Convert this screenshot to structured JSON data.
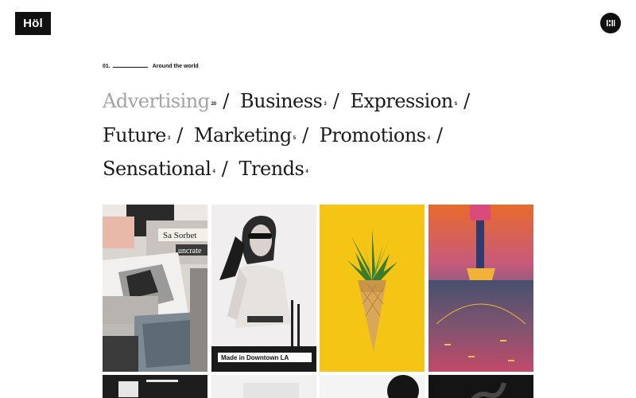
{
  "header": {
    "logo_text": "Höl",
    "menu_icon": "grid-menu-icon"
  },
  "eyebrow": {
    "number": "01.",
    "label": "Around the world"
  },
  "categories": [
    {
      "name": "Advertising",
      "count": "20",
      "active": true
    },
    {
      "name": "Business",
      "count": "3",
      "active": false
    },
    {
      "name": "Expression",
      "count": "5",
      "active": false
    },
    {
      "name": "Future",
      "count": "3",
      "active": false
    },
    {
      "name": "Marketing",
      "count": "5",
      "active": false
    },
    {
      "name": "Promotions",
      "count": "4",
      "active": false
    },
    {
      "name": "Sensational",
      "count": "4",
      "active": false
    },
    {
      "name": "Trends",
      "count": "4",
      "active": false
    }
  ],
  "separator": "/",
  "gallery": {
    "tiles": [
      {
        "subject": "magazines",
        "visible_text": "uncrate"
      },
      {
        "subject": "woman-sunglasses",
        "visible_text": "Made in Downtown LA"
      },
      {
        "subject": "pineapple-cone",
        "visible_text": ""
      },
      {
        "subject": "basketball-court",
        "visible_text": ""
      }
    ]
  },
  "colors": {
    "text": "#1a1a1a",
    "active_category": "#a3a3a3",
    "background": "#ffffff",
    "accent_yellow": "#f4c514"
  }
}
